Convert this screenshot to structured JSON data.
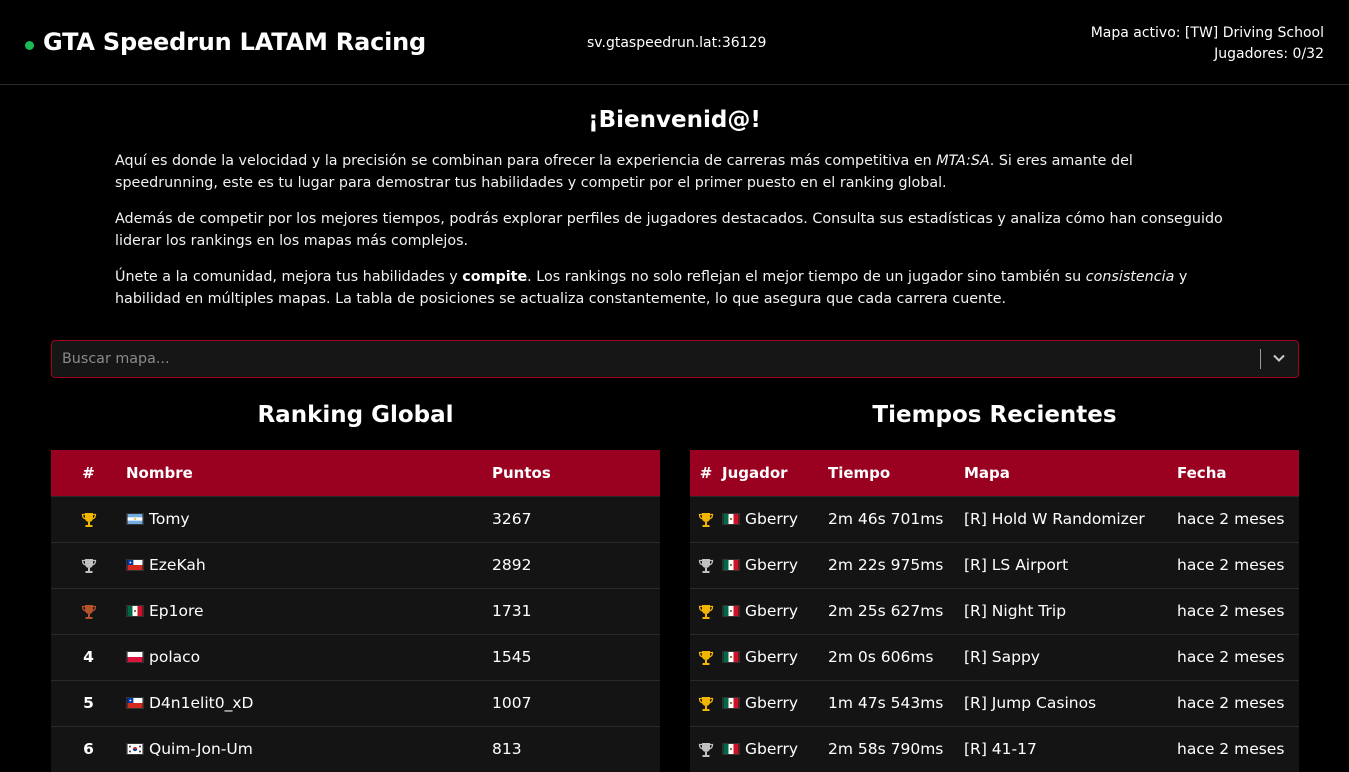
{
  "header": {
    "title": "GTA Speedrun LATAM Racing",
    "server_address": "sv.gtaspeedrun.lat:36129",
    "active_map": "Mapa activo: [TW] Driving School",
    "players": "Jugadores: 0/32",
    "status_color": "#1db954"
  },
  "welcome": {
    "title": "¡Bienvenid@!",
    "p1": [
      "Aquí es donde la velocidad y la precisión se combinan para ofrecer la experiencia de carreras más competitiva en ",
      "MTA:SA",
      ". Si eres amante del speedrunning, este es tu lugar para demostrar tus habilidades y competir por el primer puesto en el ranking global."
    ],
    "p2": "Además de competir por los mejores tiempos, podrás explorar perfiles de jugadores destacados. Consulta sus estadísticas y analiza cómo han conseguido liderar los rankings en los mapas más complejos.",
    "p3": [
      "Únete a la comunidad, mejora tus habilidades y ",
      "compite",
      ". Los rankings no solo reflejan el mejor tiempo de un jugador sino también su ",
      "consistencia",
      " y habilidad en múltiples mapas. La tabla de posiciones se actualiza constantemente, lo que asegura que cada carrera cuente."
    ]
  },
  "search": {
    "placeholder": "Buscar mapa..."
  },
  "ranking": {
    "title": "Ranking Global",
    "headers": [
      "#",
      "Nombre",
      "Puntos"
    ],
    "rows": [
      {
        "rank": "",
        "medal": "gold",
        "flag": "ar",
        "name": "Tomy",
        "points": "3267"
      },
      {
        "rank": "",
        "medal": "silver",
        "flag": "cl",
        "name": "EzeKah",
        "points": "2892"
      },
      {
        "rank": "",
        "medal": "bronze",
        "flag": "mx",
        "name": "Ep1ore",
        "points": "1731"
      },
      {
        "rank": "4",
        "medal": "",
        "flag": "pl",
        "name": "polaco",
        "points": "1545"
      },
      {
        "rank": "5",
        "medal": "",
        "flag": "cl",
        "name": "D4n1elit0_xD",
        "points": "1007"
      },
      {
        "rank": "6",
        "medal": "",
        "flag": "kr",
        "name": "Quim-Jon-Um",
        "points": "813"
      }
    ]
  },
  "recent": {
    "title": "Tiempos Recientes",
    "headers": [
      "#",
      "Jugador",
      "Tiempo",
      "Mapa",
      "Fecha"
    ],
    "rows": [
      {
        "medal": "gold",
        "flag": "mx",
        "player": "Gberry",
        "time": "2m 46s 701ms",
        "map": "[R] Hold W Randomizer",
        "date": "hace 2 meses"
      },
      {
        "medal": "silver",
        "flag": "mx",
        "player": "Gberry",
        "time": "2m 22s 975ms",
        "map": "[R] LS Airport",
        "date": "hace 2 meses"
      },
      {
        "medal": "gold",
        "flag": "mx",
        "player": "Gberry",
        "time": "2m 25s 627ms",
        "map": "[R] Night Trip",
        "date": "hace 2 meses"
      },
      {
        "medal": "gold",
        "flag": "mx",
        "player": "Gberry",
        "time": "2m 0s 606ms",
        "map": "[R] Sappy",
        "date": "hace 2 meses"
      },
      {
        "medal": "gold",
        "flag": "mx",
        "player": "Gberry",
        "time": "1m 47s 543ms",
        "map": "[R] Jump Casinos",
        "date": "hace 2 meses"
      },
      {
        "medal": "silver",
        "flag": "mx",
        "player": "Gberry",
        "time": "2m 58s 790ms",
        "map": "[R] 41-17",
        "date": "hace 2 meses"
      }
    ]
  },
  "colors": {
    "accent": "#9a0020",
    "gold": "#f2b600",
    "silver": "#c0c0c0",
    "bronze": "#b5522c"
  }
}
